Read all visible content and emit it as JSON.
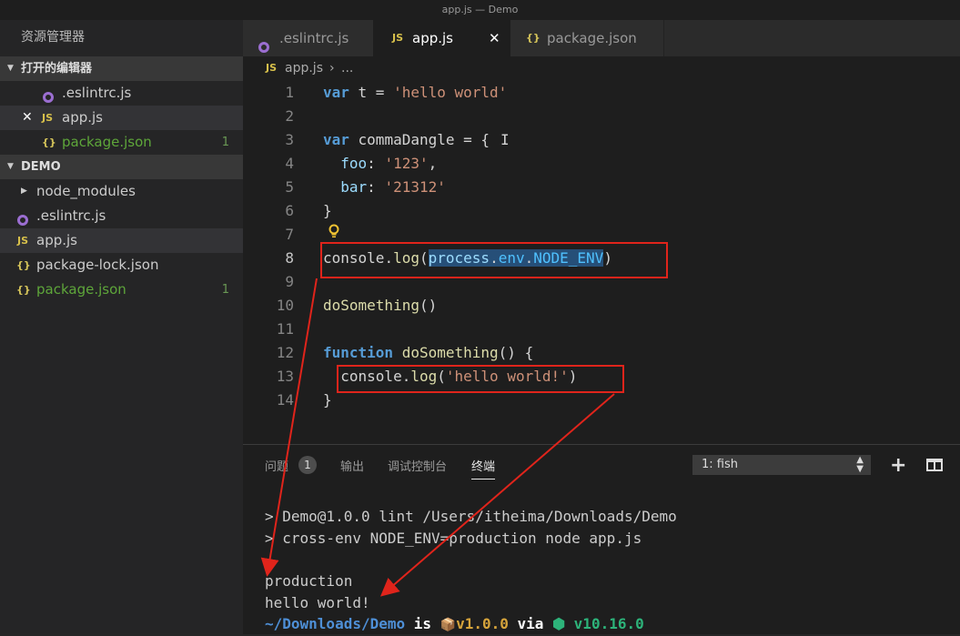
{
  "window": {
    "title": "app.js — Demo"
  },
  "sidebar": {
    "title": "资源管理器",
    "open_editors": {
      "label": "打开的编辑器",
      "items": [
        {
          "name": ".eslintrc.js",
          "icon": "eslint-icon"
        },
        {
          "name": "app.js",
          "icon": "js-icon",
          "icon_text": "JS",
          "close": "✕"
        },
        {
          "name": "package.json",
          "icon": "json-icon",
          "icon_text": "{}",
          "count": "1"
        }
      ]
    },
    "project": {
      "label": "DEMO",
      "items": [
        {
          "name": "node_modules",
          "icon": "chevron-right-icon"
        },
        {
          "name": ".eslintrc.js",
          "icon": "eslint-icon"
        },
        {
          "name": "app.js",
          "icon": "js-icon",
          "icon_text": "JS"
        },
        {
          "name": "package-lock.json",
          "icon": "json-icon",
          "icon_text": "{}"
        },
        {
          "name": "package.json",
          "icon": "json-icon",
          "icon_text": "{}",
          "count": "1"
        }
      ]
    }
  },
  "tabs": [
    {
      "label": ".eslintrc.js",
      "icon": "eslint-icon"
    },
    {
      "label": "app.js",
      "icon": "js-icon",
      "icon_text": "JS",
      "close": "✕"
    },
    {
      "label": "package.json",
      "icon": "json-icon",
      "icon_text": "{}"
    }
  ],
  "breadcrumb": {
    "icon_text": "JS",
    "file": "app.js",
    "sep": "›",
    "more": "..."
  },
  "editor": {
    "line_numbers": [
      "1",
      "2",
      "3",
      "4",
      "5",
      "6",
      "7",
      "8",
      "9",
      "10",
      "11",
      "12",
      "13",
      "14"
    ],
    "current_line": "8",
    "lines": {
      "l1": {
        "kw": "var",
        "rest": " t = ",
        "str": "'hello world'"
      },
      "l3": {
        "kw": "var",
        "rest": " commaDangle = {"
      },
      "l4": {
        "prop": "  foo",
        "colon": ": ",
        "str": "'123'",
        "tail": ","
      },
      "l5": {
        "prop": "  bar",
        "colon": ": ",
        "str": "'21312'"
      },
      "l6": {
        "text": "}"
      },
      "l8": {
        "a": "console",
        "b": ".",
        "c": "log",
        "d": "(",
        "e": "process",
        "f": ".",
        "g": "env",
        "h": ".",
        "i": "NODE_ENV",
        "j": ")"
      },
      "l10": {
        "fn": "doSomething",
        "rest": "()"
      },
      "l12": {
        "kw": "function",
        "sp": " ",
        "fn": "doSomething",
        "rest": "() {"
      },
      "l13": {
        "a": "  console",
        "b": ".",
        "c": "log",
        "d": "(",
        "str": "'hello world!'",
        "e": ")"
      },
      "l14": {
        "text": "}"
      }
    }
  },
  "panel": {
    "tabs": [
      "问题",
      "输出",
      "调试控制台",
      "终端"
    ],
    "problems_count": "1",
    "terminal_select": "1: fish",
    "terminal": {
      "l1": "> Demo@1.0.0 lint /Users/itheima/Downloads/Demo",
      "l2": "> cross-env NODE_ENV=production node app.js",
      "l3": "production",
      "l4": "hello world!",
      "prompt": {
        "path": "~/Downloads/Demo",
        "is": " is ",
        "pkg_icon": "📦",
        "version": "v1.0.0",
        "via": " via ",
        "node_icon": "⬢",
        "node_version": "v10.16.0"
      }
    }
  },
  "colors": {
    "annotation": "#e0241b",
    "selection": "#264f78",
    "modified": "#5ea63a"
  }
}
